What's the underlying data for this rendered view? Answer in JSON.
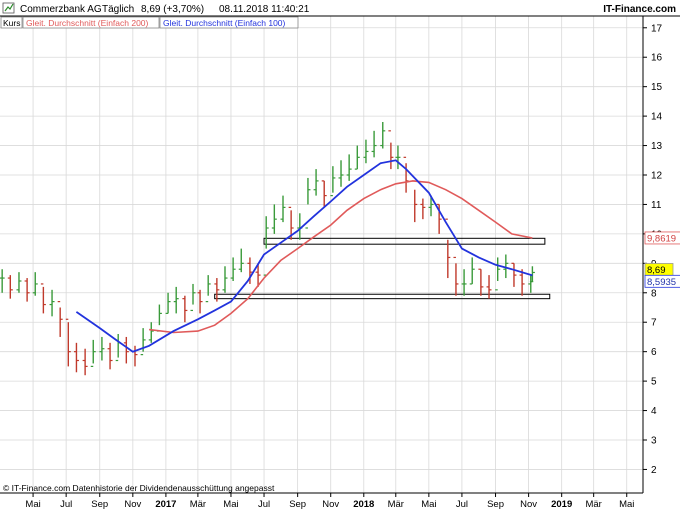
{
  "header": {
    "instrument": "Commerzbank AG",
    "period": "Täglich",
    "quote": "8,69 (+3,70%)",
    "datetime": "08.11.2018 11:40:21",
    "brand": "IT-Finance.com"
  },
  "legend": {
    "kurs": "Kurs",
    "ma200": "Gleit. Durchschnitt (Einfach 200)",
    "ma100": "Gleit. Durchschnitt (Einfach 100)"
  },
  "footer": {
    "note": "© IT-Finance.com  Datenhistorie der Dividendenausschüttung angepasst"
  },
  "colors": {
    "price_up": "#3a9a3a",
    "price_down": "#c0392b",
    "ma100": "#2233dd",
    "ma200": "#e05a5a",
    "grid": "#d9d9d9",
    "tag_last": "#ffff00",
    "tag_ma200_text": "#d04040",
    "tag_ma100_text": "#2233aa"
  },
  "chart_data": {
    "type": "line",
    "title": "Commerzbank AG",
    "x_range": [
      "2016-03-01",
      "2019-05-31"
    ],
    "ylim": [
      1.2,
      17.4
    ],
    "yticks": [
      2,
      3,
      4,
      5,
      6,
      7,
      8,
      9,
      10,
      11,
      12,
      13,
      14,
      15,
      16,
      17
    ],
    "ytick_labels": [
      "2",
      "3",
      "4",
      "5",
      "6",
      "7",
      "8",
      "9",
      "10",
      "11",
      "12",
      "13",
      "14",
      "15",
      "16",
      "17"
    ],
    "xticks": [
      {
        "date": "2016-05-01",
        "label": "Mai",
        "bold": false
      },
      {
        "date": "2016-07-01",
        "label": "Jul",
        "bold": false
      },
      {
        "date": "2016-09-01",
        "label": "Sep",
        "bold": false
      },
      {
        "date": "2016-11-01",
        "label": "Nov",
        "bold": false
      },
      {
        "date": "2017-01-01",
        "label": "2017",
        "bold": true
      },
      {
        "date": "2017-03-01",
        "label": "Mär",
        "bold": false
      },
      {
        "date": "2017-05-01",
        "label": "Mai",
        "bold": false
      },
      {
        "date": "2017-07-01",
        "label": "Jul",
        "bold": false
      },
      {
        "date": "2017-09-01",
        "label": "Sep",
        "bold": false
      },
      {
        "date": "2017-11-01",
        "label": "Nov",
        "bold": false
      },
      {
        "date": "2018-01-01",
        "label": "2018",
        "bold": true
      },
      {
        "date": "2018-03-01",
        "label": "Mär",
        "bold": false
      },
      {
        "date": "2018-05-01",
        "label": "Mai",
        "bold": false
      },
      {
        "date": "2018-07-01",
        "label": "Jul",
        "bold": false
      },
      {
        "date": "2018-09-01",
        "label": "Sep",
        "bold": false
      },
      {
        "date": "2018-11-01",
        "label": "Nov",
        "bold": false
      },
      {
        "date": "2019-01-01",
        "label": "2019",
        "bold": true
      },
      {
        "date": "2019-03-01",
        "label": "Mär",
        "bold": false
      },
      {
        "date": "2019-05-01",
        "label": "Mai",
        "bold": false
      }
    ],
    "grid": true,
    "series": [
      {
        "name": "Kurs",
        "kind": "ohlc",
        "dates": [
          "2016-03-05",
          "2016-03-20",
          "2016-04-05",
          "2016-04-20",
          "2016-05-05",
          "2016-05-20",
          "2016-06-05",
          "2016-06-20",
          "2016-07-05",
          "2016-07-20",
          "2016-08-05",
          "2016-08-20",
          "2016-09-05",
          "2016-09-20",
          "2016-10-05",
          "2016-10-20",
          "2016-11-05",
          "2016-11-20",
          "2016-12-05",
          "2016-12-20",
          "2017-01-05",
          "2017-01-20",
          "2017-02-05",
          "2017-02-20",
          "2017-03-05",
          "2017-03-20",
          "2017-04-05",
          "2017-04-20",
          "2017-05-05",
          "2017-05-20",
          "2017-06-05",
          "2017-06-20",
          "2017-07-05",
          "2017-07-20",
          "2017-08-05",
          "2017-08-20",
          "2017-09-05",
          "2017-09-20",
          "2017-10-05",
          "2017-10-20",
          "2017-11-05",
          "2017-11-20",
          "2017-12-05",
          "2017-12-20",
          "2018-01-05",
          "2018-01-20",
          "2018-02-05",
          "2018-02-20",
          "2018-03-05",
          "2018-03-20",
          "2018-04-05",
          "2018-04-20",
          "2018-05-05",
          "2018-05-20",
          "2018-06-05",
          "2018-06-20",
          "2018-07-05",
          "2018-07-20",
          "2018-08-05",
          "2018-08-20",
          "2018-09-05",
          "2018-09-20",
          "2018-10-05",
          "2018-10-20",
          "2018-11-05",
          "2018-11-08"
        ],
        "close": [
          8.5,
          8.1,
          8.4,
          8.0,
          8.3,
          7.6,
          7.7,
          7.1,
          6.0,
          5.7,
          5.5,
          6.0,
          6.1,
          5.7,
          6.3,
          6.0,
          5.9,
          6.4,
          6.7,
          7.3,
          7.7,
          7.8,
          7.4,
          8.0,
          7.7,
          8.3,
          8.1,
          8.5,
          8.8,
          9.0,
          8.7,
          8.6,
          10.2,
          10.5,
          10.9,
          10.2,
          10.2,
          11.5,
          11.8,
          11.3,
          11.9,
          12.0,
          12.2,
          12.6,
          12.8,
          13.0,
          13.5,
          12.6,
          12.6,
          11.8,
          11.0,
          10.9,
          11.0,
          10.5,
          9.2,
          8.3,
          8.3,
          8.8,
          8.2,
          8.1,
          8.8,
          9.0,
          8.6,
          8.3,
          8.38,
          8.69
        ],
        "high": [
          8.8,
          8.6,
          8.7,
          8.5,
          8.7,
          8.2,
          8.1,
          7.5,
          7.0,
          6.3,
          6.1,
          6.4,
          6.5,
          6.3,
          6.6,
          6.5,
          6.2,
          6.8,
          7.0,
          7.6,
          8.0,
          8.2,
          7.9,
          8.3,
          8.1,
          8.6,
          8.5,
          8.9,
          9.2,
          9.5,
          9.2,
          9.0,
          10.6,
          11.0,
          11.3,
          10.8,
          10.7,
          11.9,
          12.2,
          11.8,
          12.3,
          12.5,
          12.7,
          13.0,
          13.2,
          13.5,
          13.8,
          13.1,
          13.0,
          12.4,
          11.5,
          11.2,
          11.3,
          11.0,
          9.8,
          9.0,
          8.8,
          9.2,
          8.8,
          8.6,
          9.2,
          9.3,
          9.0,
          8.8,
          8.6,
          8.9
        ],
        "low": [
          8.0,
          7.8,
          8.0,
          7.7,
          7.9,
          7.3,
          7.2,
          6.5,
          5.5,
          5.3,
          5.2,
          5.6,
          5.7,
          5.4,
          5.8,
          5.6,
          5.5,
          6.0,
          6.3,
          6.9,
          7.3,
          7.3,
          7.0,
          7.6,
          7.3,
          7.9,
          7.7,
          8.0,
          8.4,
          8.7,
          8.3,
          8.2,
          9.5,
          10.0,
          10.4,
          9.8,
          9.8,
          11.0,
          11.3,
          10.9,
          11.4,
          11.6,
          11.8,
          12.2,
          12.4,
          12.6,
          12.9,
          12.2,
          12.2,
          11.4,
          10.4,
          10.5,
          10.6,
          10.0,
          8.5,
          7.9,
          7.9,
          8.3,
          7.9,
          7.8,
          8.4,
          8.5,
          8.2,
          7.9,
          8.0,
          8.4
        ]
      },
      {
        "name": "Gleit. Durchschnitt (Einfach 100)",
        "dates": [
          "2016-07-20",
          "2016-09-01",
          "2016-10-01",
          "2016-11-01",
          "2016-12-01",
          "2017-01-15",
          "2017-03-01",
          "2017-04-01",
          "2017-05-01",
          "2017-06-01",
          "2017-07-01",
          "2017-08-01",
          "2017-09-01",
          "2017-10-01",
          "2017-11-01",
          "2017-12-01",
          "2018-01-01",
          "2018-02-01",
          "2018-03-01",
          "2018-03-20",
          "2018-05-01",
          "2018-06-01",
          "2018-07-01",
          "2018-08-01",
          "2018-09-01",
          "2018-10-01",
          "2018-11-08"
        ],
        "values": [
          7.35,
          6.8,
          6.4,
          6.0,
          6.2,
          6.7,
          7.1,
          7.4,
          7.7,
          8.4,
          9.3,
          9.7,
          10.1,
          10.6,
          11.1,
          11.6,
          12.0,
          12.4,
          12.5,
          12.2,
          11.4,
          10.4,
          9.5,
          9.2,
          8.95,
          8.8,
          8.59
        ]
      },
      {
        "name": "Gleit. Durchschnitt (Einfach 200)",
        "dates": [
          "2016-12-01",
          "2017-01-15",
          "2017-03-01",
          "2017-04-01",
          "2017-05-01",
          "2017-06-01",
          "2017-07-01",
          "2017-08-01",
          "2017-09-01",
          "2017-10-01",
          "2017-11-01",
          "2017-12-01",
          "2018-01-01",
          "2018-02-01",
          "2018-03-01",
          "2018-04-01",
          "2018-05-01",
          "2018-06-01",
          "2018-07-01",
          "2018-08-01",
          "2018-09-01",
          "2018-10-01",
          "2018-11-08"
        ],
        "values": [
          6.75,
          6.65,
          6.7,
          6.9,
          7.3,
          7.8,
          8.5,
          9.1,
          9.5,
          9.9,
          10.3,
          10.8,
          11.2,
          11.5,
          11.7,
          11.8,
          11.75,
          11.5,
          11.2,
          10.8,
          10.4,
          10.0,
          9.86
        ]
      }
    ],
    "annotations": [
      {
        "kind": "rectangle",
        "x_start": "2017-07-01",
        "x_end": "2018-12-01",
        "y_bottom": 9.65,
        "y_top": 9.85
      },
      {
        "kind": "rectangle",
        "x_start": "2017-04-01",
        "x_end": "2018-12-10",
        "y_bottom": 7.8,
        "y_top": 7.95
      }
    ],
    "last_value_tags": [
      {
        "series": "Kurs",
        "value": 8.69,
        "label": "8,69"
      },
      {
        "series": "Gleit. Durchschnitt (Einfach 200)",
        "value": 9.8619,
        "label": "9,8619"
      },
      {
        "series": "Gleit. Durchschnitt (Einfach 100)",
        "value": 8.5935,
        "label": "8,5935"
      }
    ]
  }
}
